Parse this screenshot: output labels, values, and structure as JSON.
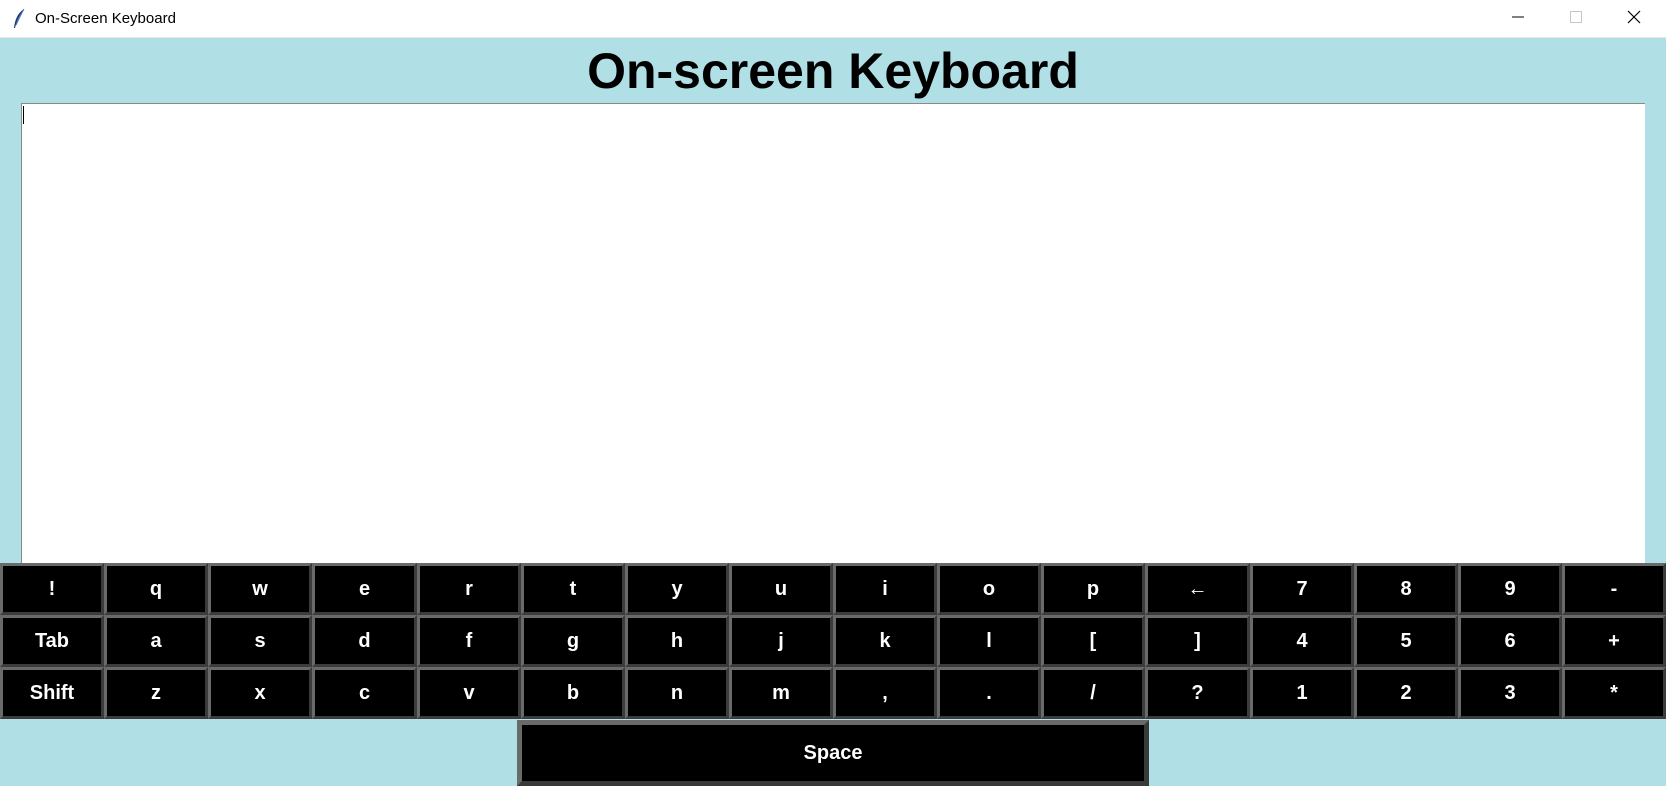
{
  "window": {
    "title": "On-Screen Keyboard",
    "app_icon": "feather-icon",
    "minimize_icon": "minimize-icon",
    "maximize_icon": "maximize-icon",
    "close_icon": "close-icon"
  },
  "heading": "On-screen Keyboard",
  "text_area": {
    "value": ""
  },
  "keyboard": {
    "rows": [
      [
        "!",
        "q",
        "w",
        "e",
        "r",
        "t",
        "y",
        "u",
        "i",
        "o",
        "p",
        "←",
        "7",
        "8",
        "9",
        "-"
      ],
      [
        "Tab",
        "a",
        "s",
        "d",
        "f",
        "g",
        "h",
        "j",
        "k",
        "l",
        "[",
        "]",
        "4",
        "5",
        "6",
        "+"
      ],
      [
        "Shift",
        "z",
        "x",
        "c",
        "v",
        "b",
        "n",
        "m",
        ",",
        ".",
        "/",
        "?",
        "1",
        "2",
        "3",
        "*"
      ]
    ],
    "space_label": "Space"
  },
  "colors": {
    "background": "#b0dfe5",
    "key_background": "#000000",
    "key_text": "#ffffff",
    "key_border": "#5a5a5a"
  }
}
